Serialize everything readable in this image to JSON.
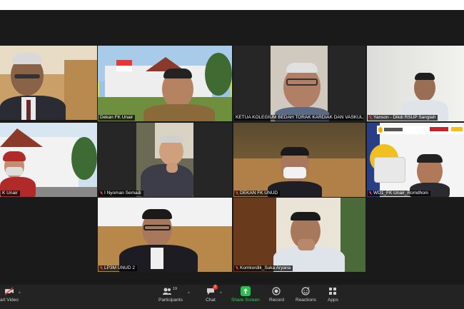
{
  "participants": [
    {
      "name": "",
      "muted": false
    },
    {
      "name": "Dekan FK Unair",
      "muted": false,
      "active": true
    },
    {
      "name": "KETUA KOLEGIUM BEDAH TORAK KARDIAK DAN VASKULAR _K...",
      "muted": false
    },
    {
      "name": "Yanson - Dikdi RSUP Sanglah",
      "muted": true
    },
    {
      "name": "K Unair",
      "muted": false
    },
    {
      "name": "I Nyoman Semadi",
      "muted": true
    },
    {
      "name": "DEKAN FK UNUD",
      "muted": true
    },
    {
      "name": "WD1_FK Unair_Romdhoni",
      "muted": true
    },
    {
      "name": "LP3M UNUD 2",
      "muted": true
    },
    {
      "name": "Komkordik_Suka Aryana",
      "muted": true
    }
  ],
  "toolbar": {
    "start_video": "art Video",
    "participants_label": "Participants",
    "participants_count": "19",
    "chat_label": "Chat",
    "chat_badge": "2",
    "share_label": "Share Screen",
    "record_label": "Record",
    "reactions_label": "Reactions",
    "apps_label": "Apps"
  },
  "colors": {
    "active_border": "#d8e030",
    "share_green": "#27c24c",
    "muted_red": "#e53935"
  }
}
